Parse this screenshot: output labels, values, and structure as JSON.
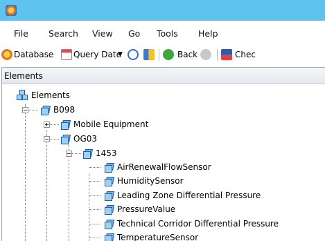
{
  "menu": [
    "File",
    "Search",
    "View",
    "Go",
    "Tools",
    "Help"
  ],
  "toolbar": {
    "database": "Database",
    "query_date": "Query Date",
    "back": "Back",
    "check": "Chec"
  },
  "panel": {
    "title": "Elements"
  },
  "tree": {
    "root": "Elements",
    "b098": "B098",
    "mobile_equipment": "Mobile Equipment",
    "og03": "OG03",
    "n1453": "1453",
    "sensors": [
      "AirRenewalFlowSensor",
      "HumiditySensor",
      "Leading Zone Differential Pressure",
      "PressureValue",
      "Technical Corridor Differential Pressure",
      "TemperatureSensor"
    ]
  },
  "colors": {
    "titlebar": "#5fc3ef",
    "panel_header": "#e8ecf1"
  }
}
